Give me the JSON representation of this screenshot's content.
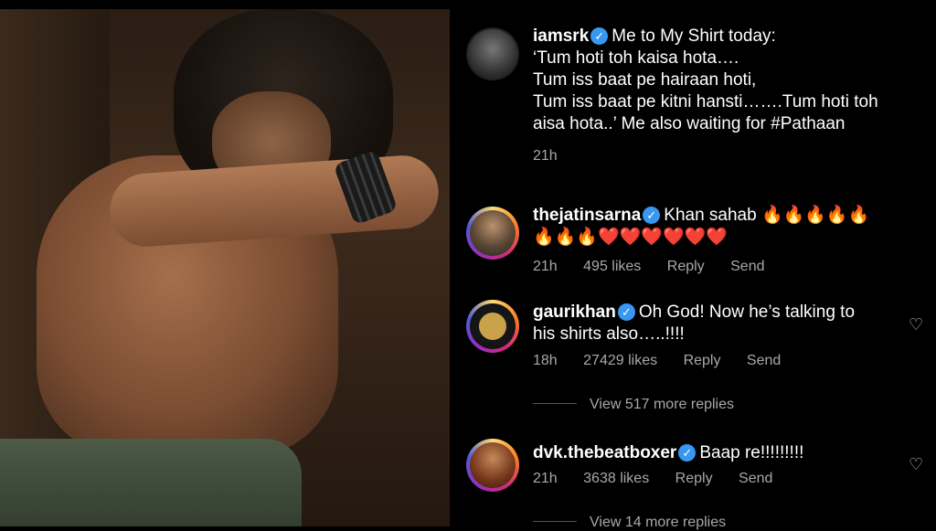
{
  "post": {
    "username": "iamsrk",
    "caption": "Me to My Shirt today: ‘Tum hoti toh kaisa hota…. Tum iss baat pe hairaan hoti, Tum iss baat pe kitni hansti…….Tum hoti toh aisa hota..’ Me also waiting for #Pathaan",
    "caption_lines": [
      "Me to My Shirt today:",
      "‘Tum hoti toh kaisa hota….",
      "Tum iss baat pe hairaan hoti,",
      "Tum iss baat pe kitni hansti…….Tum hoti toh",
      "aisa hota..’ Me also waiting for #Pathaan"
    ],
    "time": "21h"
  },
  "comments": [
    {
      "username": "thejatinsarna",
      "line1": "Khan sahab 🔥🔥🔥🔥🔥",
      "line2": "🔥🔥🔥❤️❤️❤️❤️❤️❤️",
      "time": "21h",
      "likes": "495 likes",
      "reply": "Reply",
      "send": "Send"
    },
    {
      "username": "gaurikhan",
      "line1": "Oh God! Now he’s talking to",
      "line2": "his shirts also…..!!!!",
      "time": "18h",
      "likes": "27429 likes",
      "reply": "Reply",
      "send": "Send",
      "view_replies": "View 517 more replies"
    },
    {
      "username": "dvk.thebeatboxer",
      "line1": "Baap re!!!!!!!!!",
      "time": "21h",
      "likes": "3638 likes",
      "reply": "Reply",
      "send": "Send",
      "view_replies": "View 14 more replies"
    }
  ],
  "icons": {
    "verified": "verified-badge-icon",
    "heart": "heart-outline-icon"
  },
  "colors": {
    "background": "#000000",
    "meta_text": "#a8a8a8",
    "verified": "#3897f0"
  }
}
